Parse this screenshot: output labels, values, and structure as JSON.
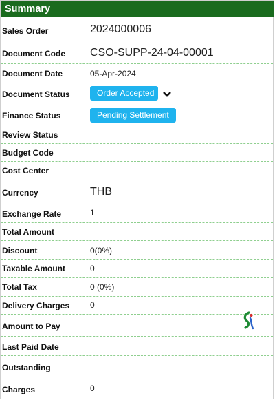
{
  "header": {
    "title": "Summary"
  },
  "rows": {
    "sales_order": {
      "label": "Sales Order",
      "value": "2024000006"
    },
    "document_code": {
      "label": "Document Code",
      "value": "CSO-SUPP-24-04-00001"
    },
    "document_date": {
      "label": "Document Date",
      "value": "05-Apr-2024"
    },
    "document_status": {
      "label": "Document Status",
      "value": "Order Accepted"
    },
    "finance_status": {
      "label": "Finance Status",
      "value": "Pending Settlement"
    },
    "review_status": {
      "label": "Review Status",
      "value": ""
    },
    "budget_code": {
      "label": "Budget Code",
      "value": ""
    },
    "cost_center": {
      "label": "Cost Center",
      "value": ""
    },
    "currency": {
      "label": "Currency",
      "value": "THB"
    },
    "exchange_rate": {
      "label": "Exchange Rate",
      "value": "1"
    },
    "total_amount": {
      "label": "Total Amount",
      "value": ""
    },
    "discount": {
      "label": "Discount",
      "value": "0(0%)"
    },
    "taxable_amount": {
      "label": "Taxable Amount",
      "value": "0"
    },
    "total_tax": {
      "label": "Total Tax",
      "value": "0 (0%)"
    },
    "delivery_charges": {
      "label": "Delivery Charges",
      "value": "0"
    },
    "amount_to_pay": {
      "label": "Amount to Pay",
      "value": ""
    },
    "last_paid_date": {
      "label": "Last Paid Date",
      "value": ""
    },
    "outstanding": {
      "label": "Outstanding",
      "value": ""
    },
    "charges": {
      "label": "Charges",
      "value": "0"
    }
  },
  "colors": {
    "header_bg": "#1a6b1e",
    "badge_bg": "#1fb3ee",
    "divider": "#8fcf8f"
  },
  "icons": {
    "status_dropdown": "chevron-down-icon",
    "loading": "loading-logo-icon"
  }
}
